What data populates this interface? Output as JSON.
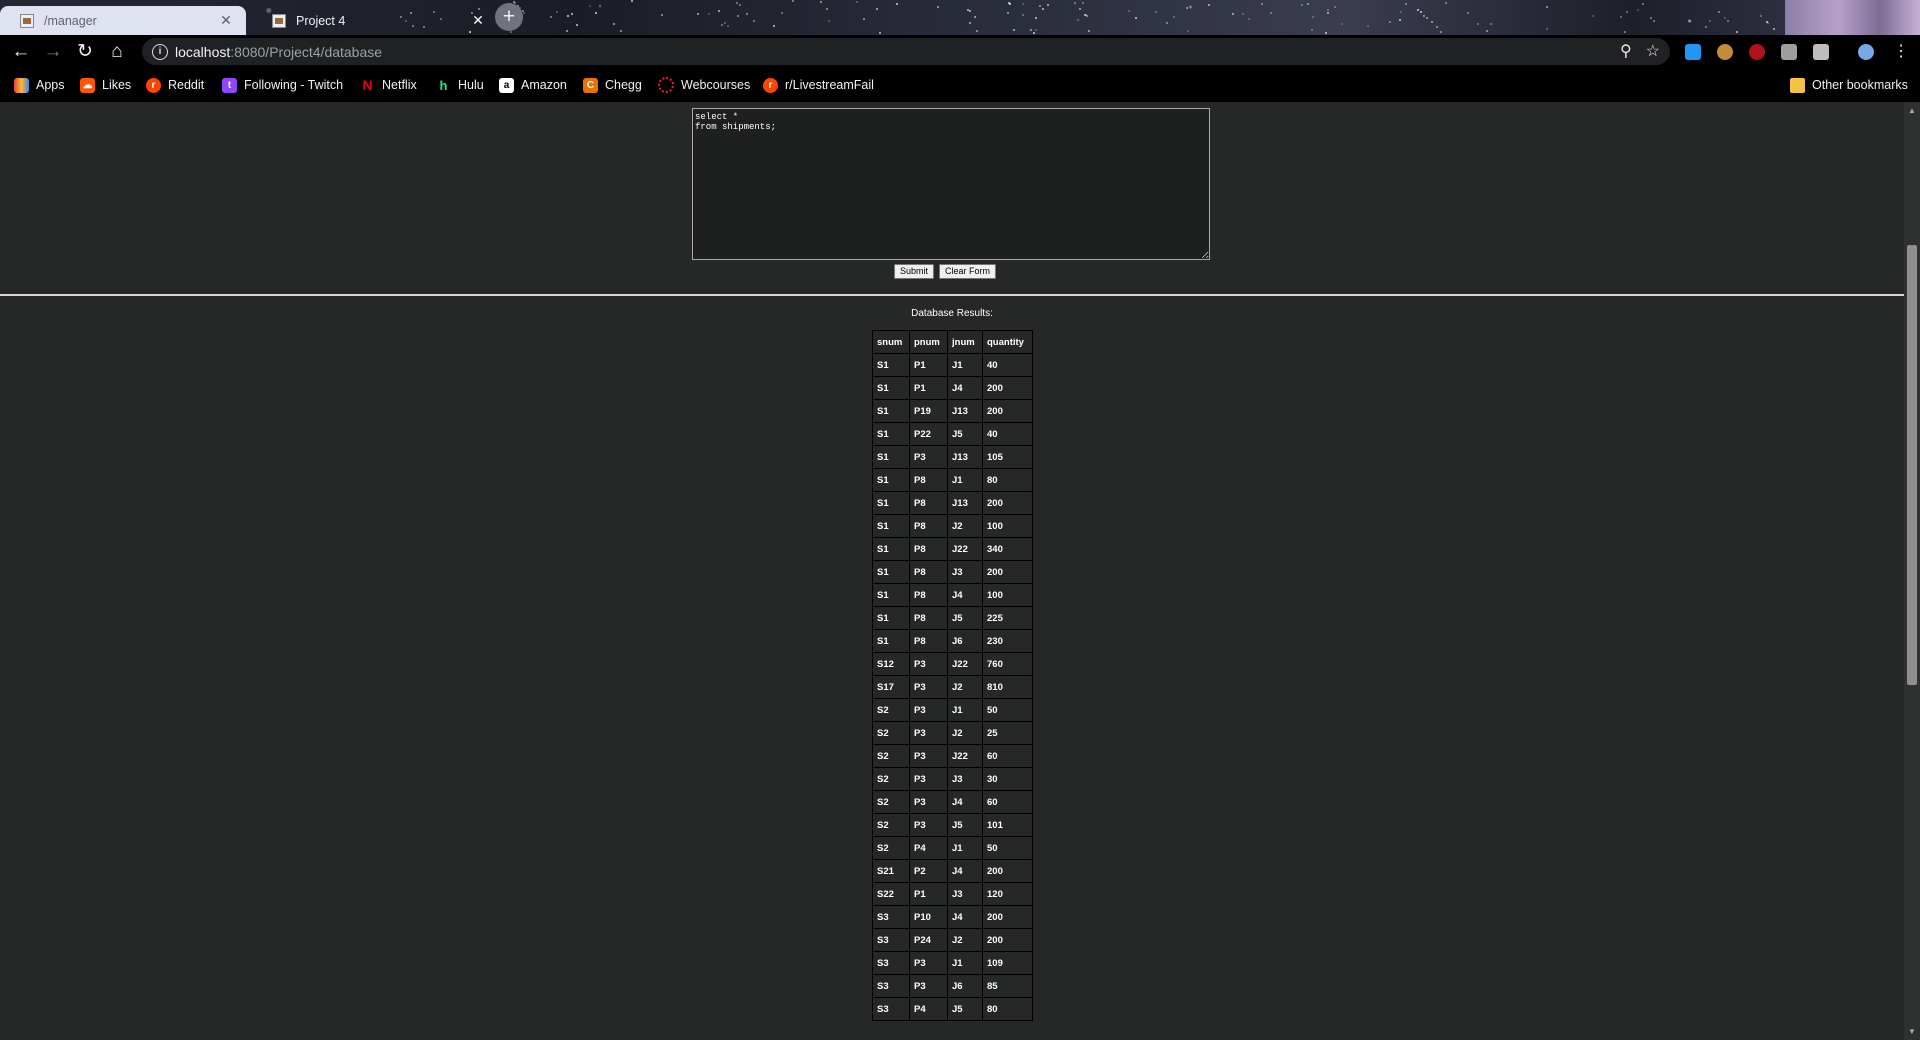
{
  "browser": {
    "tabs": [
      {
        "title": "/manager"
      },
      {
        "title": "Project 4"
      }
    ],
    "new_tab_icon": "+",
    "url_host": "localhost",
    "url_rest": ":8080/Project4/database",
    "bookmarks": [
      {
        "label": "Apps",
        "icon": "apps-grid-icon",
        "color": "#e8453c"
      },
      {
        "label": "Likes",
        "icon": "soundcloud-icon",
        "color": "#ff5500"
      },
      {
        "label": "Reddit",
        "icon": "reddit-icon",
        "color": "#ff4500"
      },
      {
        "label": "Following - Twitch",
        "icon": "twitch-icon",
        "color": "#9146ff"
      },
      {
        "label": "Netflix",
        "icon": "netflix-icon",
        "color": "#e50914"
      },
      {
        "label": "Hulu",
        "icon": "hulu-icon",
        "color": "#1ce783"
      },
      {
        "label": "Amazon",
        "icon": "amazon-icon",
        "color": "#ffffff"
      },
      {
        "label": "Chegg",
        "icon": "chegg-icon",
        "color": "#eb7100"
      },
      {
        "label": "Webcourses",
        "icon": "webcourses-icon",
        "color": "#e72429"
      },
      {
        "label": "r/LivestreamFail",
        "icon": "reddit-icon",
        "color": "#ff4500"
      }
    ],
    "other_bookmarks": "Other bookmarks"
  },
  "form": {
    "query": "select *\nfrom shipments;",
    "submit_label": "Submit",
    "clear_label": "Clear Form"
  },
  "results": {
    "title": "Database Results:",
    "columns": [
      "snum",
      "pnum",
      "jnum",
      "quantity"
    ],
    "rows": [
      [
        "S1",
        "P1",
        "J1",
        "40"
      ],
      [
        "S1",
        "P1",
        "J4",
        "200"
      ],
      [
        "S1",
        "P19",
        "J13",
        "200"
      ],
      [
        "S1",
        "P22",
        "J5",
        "40"
      ],
      [
        "S1",
        "P3",
        "J13",
        "105"
      ],
      [
        "S1",
        "P8",
        "J1",
        "80"
      ],
      [
        "S1",
        "P8",
        "J13",
        "200"
      ],
      [
        "S1",
        "P8",
        "J2",
        "100"
      ],
      [
        "S1",
        "P8",
        "J22",
        "340"
      ],
      [
        "S1",
        "P8",
        "J3",
        "200"
      ],
      [
        "S1",
        "P8",
        "J4",
        "100"
      ],
      [
        "S1",
        "P8",
        "J5",
        "225"
      ],
      [
        "S1",
        "P8",
        "J6",
        "230"
      ],
      [
        "S12",
        "P3",
        "J22",
        "760"
      ],
      [
        "S17",
        "P3",
        "J2",
        "810"
      ],
      [
        "S2",
        "P3",
        "J1",
        "50"
      ],
      [
        "S2",
        "P3",
        "J2",
        "25"
      ],
      [
        "S2",
        "P3",
        "J22",
        "60"
      ],
      [
        "S2",
        "P3",
        "J3",
        "30"
      ],
      [
        "S2",
        "P3",
        "J4",
        "60"
      ],
      [
        "S2",
        "P3",
        "J5",
        "101"
      ],
      [
        "S2",
        "P4",
        "J1",
        "50"
      ],
      [
        "S21",
        "P2",
        "J4",
        "200"
      ],
      [
        "S22",
        "P1",
        "J3",
        "120"
      ],
      [
        "S3",
        "P10",
        "J4",
        "200"
      ],
      [
        "S3",
        "P24",
        "J2",
        "200"
      ],
      [
        "S3",
        "P3",
        "J1",
        "109"
      ],
      [
        "S3",
        "P3",
        "J6",
        "85"
      ],
      [
        "S3",
        "P4",
        "J5",
        "80"
      ]
    ]
  }
}
